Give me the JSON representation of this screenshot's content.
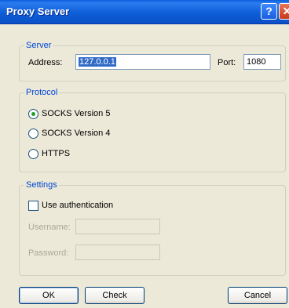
{
  "window": {
    "title": "Proxy Server",
    "help_glyph": "?",
    "close_glyph": "✕"
  },
  "server": {
    "legend": "Server",
    "address_label": "Address:",
    "address_value": "127.0.0.1",
    "port_label": "Port:",
    "port_value": "1080"
  },
  "protocol": {
    "legend": "Protocol",
    "options": [
      {
        "label": "SOCKS Version 5",
        "selected": true
      },
      {
        "label": "SOCKS Version 4",
        "selected": false
      },
      {
        "label": "HTTPS",
        "selected": false
      }
    ]
  },
  "settings": {
    "legend": "Settings",
    "use_auth_label": "Use authentication",
    "use_auth_checked": false,
    "username_label": "Username:",
    "username_value": "",
    "password_label": "Password:",
    "password_value": ""
  },
  "buttons": {
    "ok": "OK",
    "check": "Check",
    "cancel": "Cancel"
  },
  "colors": {
    "titlebar": "#0A5EDB",
    "legend": "#0046D5",
    "dialog_bg": "#ECE9D8",
    "radio_dot": "#21A121"
  }
}
